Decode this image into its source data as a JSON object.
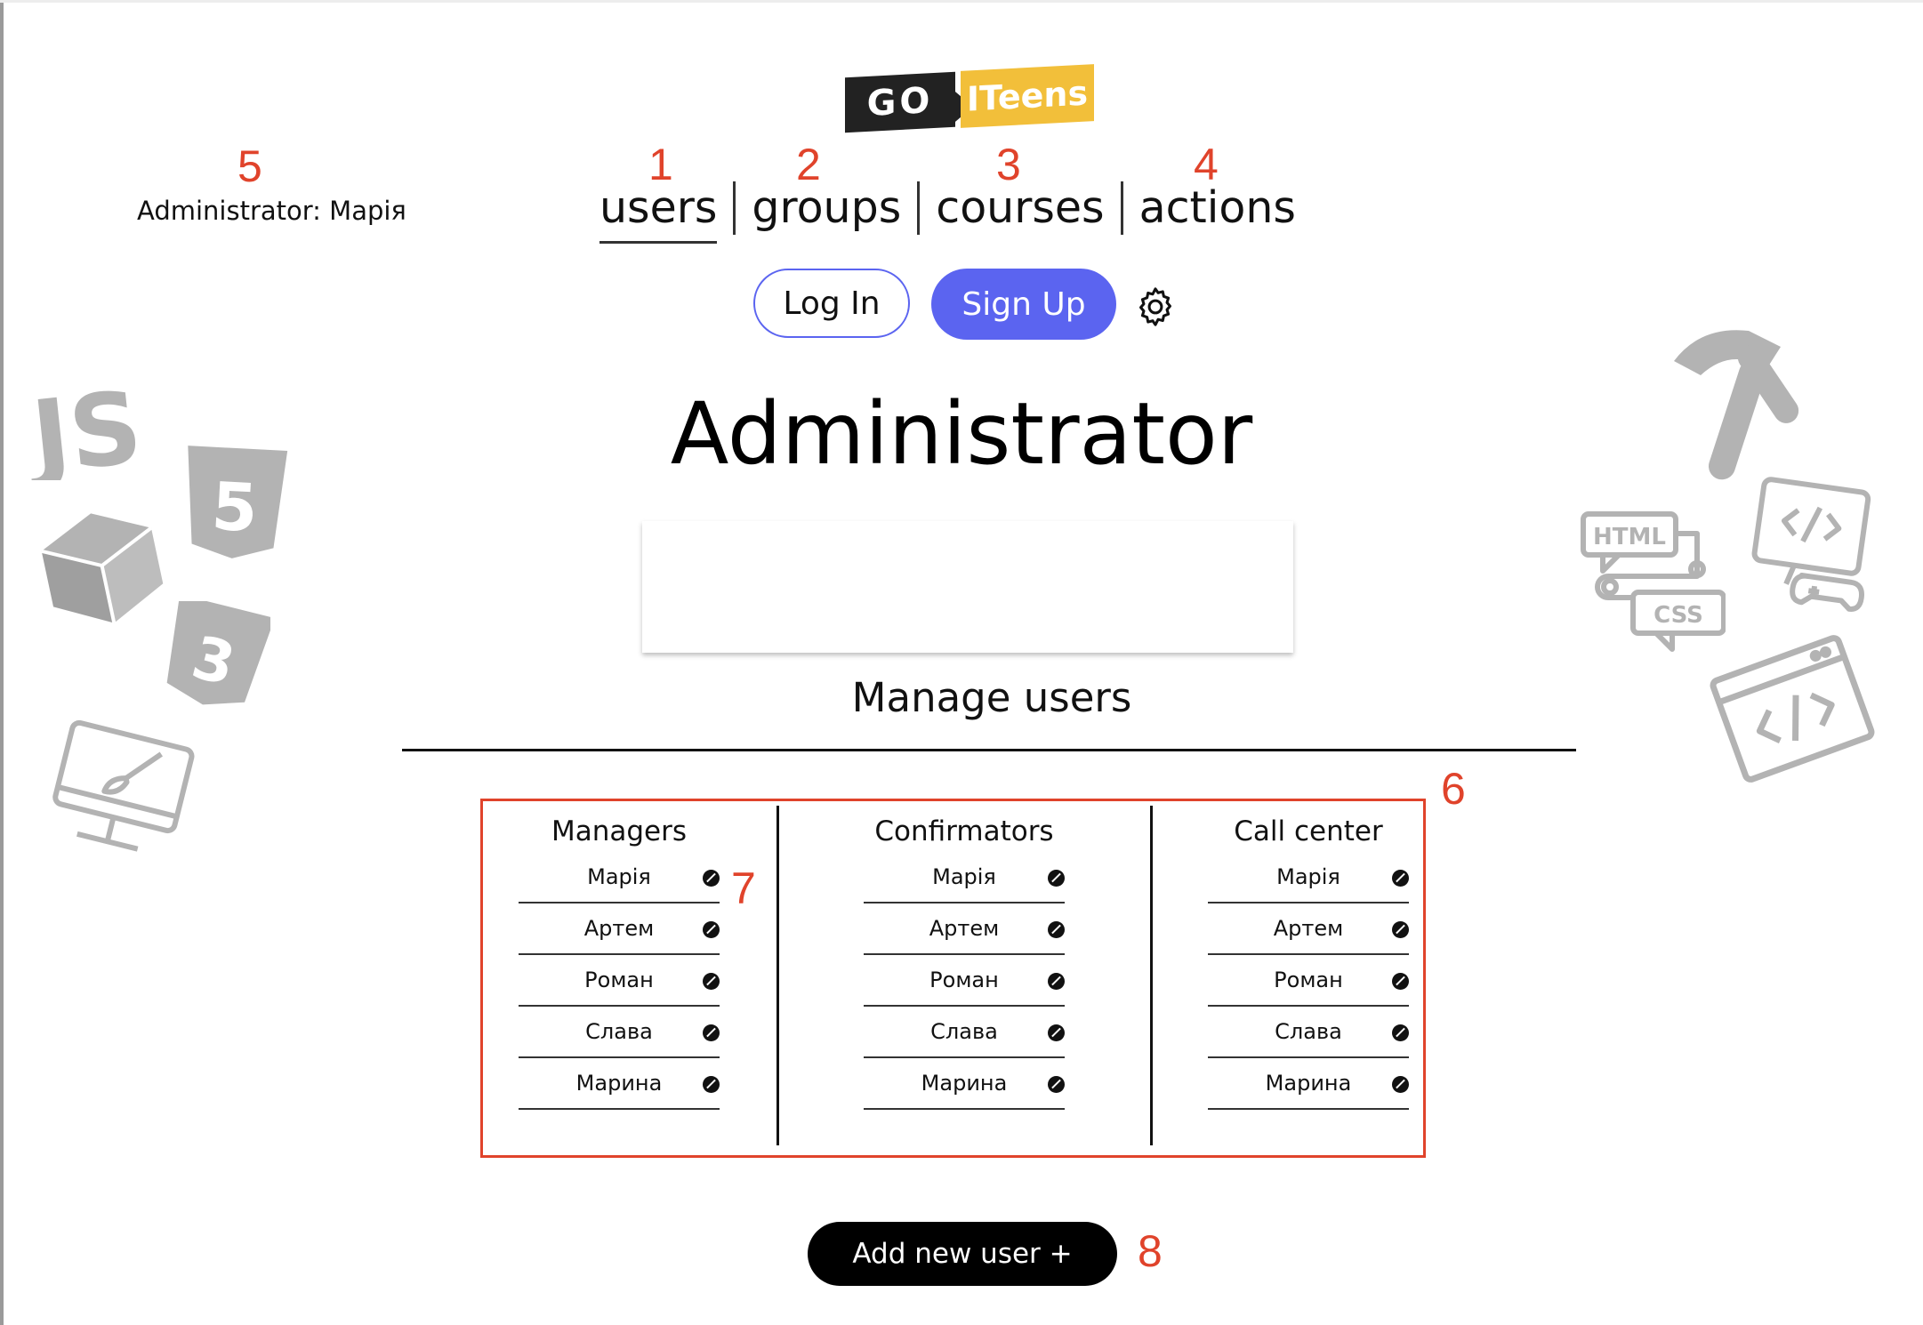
{
  "logo": {
    "go": "GO",
    "brand": "ITeens"
  },
  "annotations": {
    "n1": "1",
    "n2": "2",
    "n3": "3",
    "n4": "4",
    "n5": "5",
    "n6": "6",
    "n7": "7",
    "n8": "8"
  },
  "header": {
    "admin_label": "Administrator: Марія"
  },
  "nav": {
    "users": "users",
    "groups": "groups",
    "courses": "courses",
    "actions": "actions"
  },
  "auth": {
    "login": "Log In",
    "signup": "Sign Up"
  },
  "main": {
    "title": "Administrator",
    "section_title": "Manage users"
  },
  "groups": [
    {
      "title": "Managers",
      "members": [
        "Марія",
        "Артем",
        "Роман",
        "Слава",
        "Марина"
      ]
    },
    {
      "title": "Confirmators",
      "members": [
        "Марія",
        "Артем",
        "Роман",
        "Слава",
        "Марина"
      ]
    },
    {
      "title": "Call center",
      "members": [
        "Марія",
        "Артем",
        "Роман",
        "Слава",
        "Марина"
      ]
    }
  ],
  "add_button": "Add new user +",
  "decor": {
    "js": "JS",
    "html": "HTML",
    "css": "CSS"
  },
  "colors": {
    "accent": "#5b64f0",
    "annotation": "#e0432b",
    "logo_yellow": "#f2bf3a",
    "decor_gray": "#b3b3b3"
  }
}
